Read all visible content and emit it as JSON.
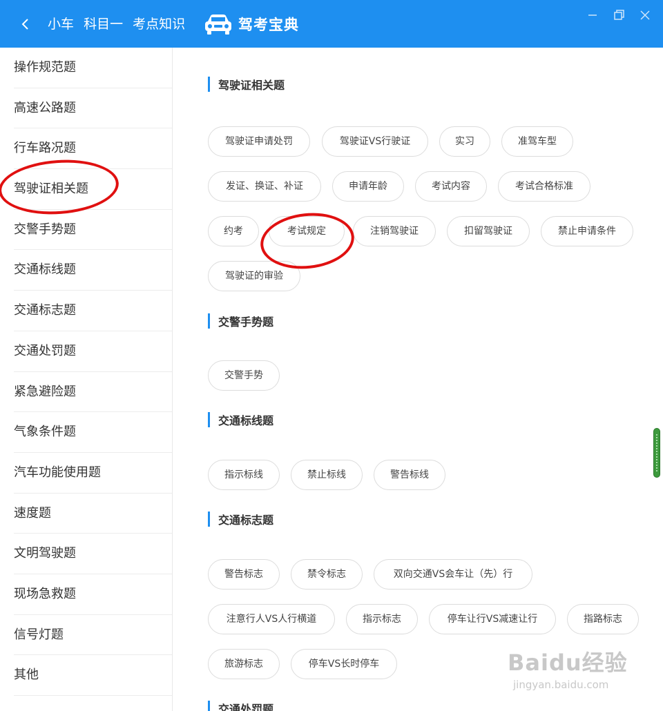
{
  "header": {
    "crumbs": [
      "小车",
      "科目一",
      "考点知识"
    ],
    "brand": "驾考宝典",
    "bg_color": "#1e8ff0"
  },
  "sidebar": {
    "items": [
      "操作规范题",
      "高速公路题",
      "行车路况题",
      "驾驶证相关题",
      "交警手势题",
      "交通标线题",
      "交通标志题",
      "交通处罚题",
      "紧急避险题",
      "气象条件题",
      "汽车功能使用题",
      "速度题",
      "文明驾驶题",
      "现场急救题",
      "信号灯题",
      "其他"
    ]
  },
  "sections": [
    {
      "title": "驾驶证相关题",
      "chips": [
        "驾驶证申请处罚",
        "驾驶证VS行驶证",
        "实习",
        "准驾车型",
        "发证、换证、补证",
        "申请年龄",
        "考试内容",
        "考试合格标准",
        "约考",
        "考试规定",
        "注销驾驶证",
        "扣留驾驶证",
        "禁止申请条件",
        "驾驶证的审验"
      ]
    },
    {
      "title": "交警手势题",
      "chips": [
        "交警手势"
      ]
    },
    {
      "title": "交通标线题",
      "chips": [
        "指示标线",
        "禁止标线",
        "警告标线"
      ]
    },
    {
      "title": "交通标志题",
      "chips": [
        "警告标志",
        "禁令标志",
        "双向交通VS会车让（先）行",
        "注意行人VS人行横道",
        "指示标志",
        "停车让行VS减速让行",
        "指路标志",
        "旅游标志",
        "停车VS长时停车"
      ]
    },
    {
      "title": "交通处罚题",
      "chips": []
    }
  ],
  "watermark": {
    "main": "Baidu经验",
    "sub": "jingyan.baidu.com"
  },
  "annotation_color": "#e01010",
  "icons": [
    "back-arrow-icon",
    "car-logo-icon",
    "minimize-icon",
    "restore-icon",
    "close-icon"
  ]
}
